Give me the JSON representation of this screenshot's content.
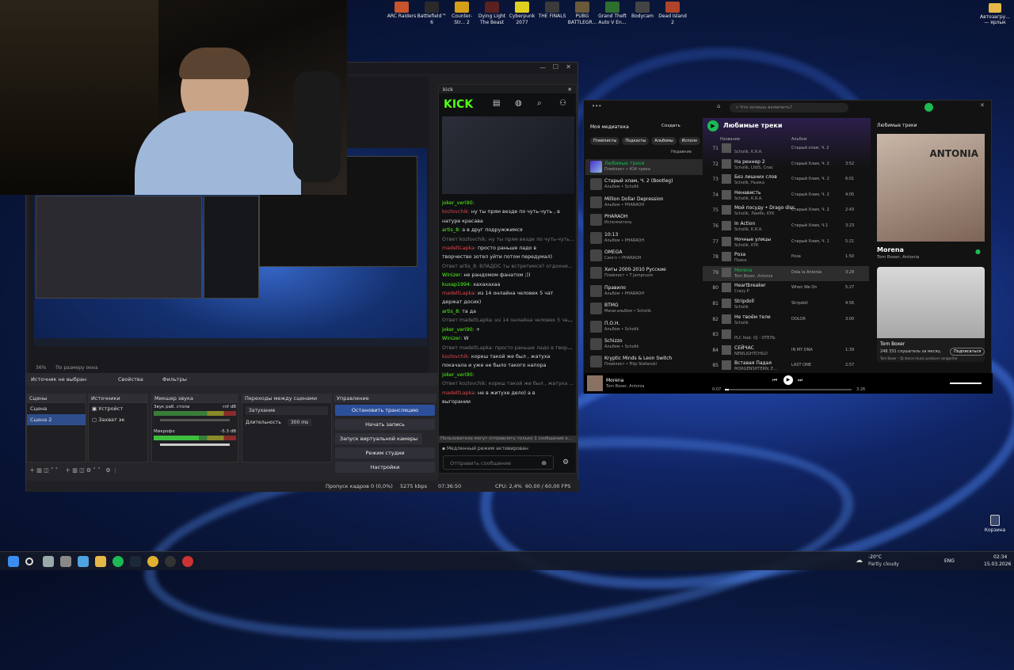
{
  "desktop": {
    "icons": [
      "ARC Raiders",
      "Battlefield™ 6",
      "Counter-Str... 2",
      "Dying Light The Beast",
      "Cyberpunk 2077",
      "THE FINALS",
      "PUBG BATTLEGR...",
      "Grand Theft Auto V En...",
      "Bodycam",
      "Dead Island 2"
    ],
    "right_icon": "Автозагру... — ярлык",
    "trash": "Корзина"
  },
  "obs": {
    "zoom": "36%",
    "fit": "По размеру окна",
    "source_none": "Источник не выбран",
    "props": "Свойства",
    "filters": "Фильтры",
    "scenes_title": "Сцены",
    "scenes": [
      "Сцена",
      "Сцена 2"
    ],
    "sources_title": "Источники",
    "sources": [
      "Устройст",
      "Захват эк"
    ],
    "mixer_title": "Микшер звука",
    "mixer": [
      {
        "name": "Звук раб. стола",
        "db": "-inf dB"
      },
      {
        "name": "Микрофо",
        "db": "-5.3 dB"
      }
    ],
    "trans_title": "Переходы между сценами",
    "trans": "Затухание",
    "dur_label": "Длительность",
    "dur": "300 ms",
    "ctrl_title": "Управление",
    "controls": [
      "Остановить трансляцию",
      "Начать запись",
      "Запуск виртуальной камеры",
      "Режим студии",
      "Настройки"
    ],
    "status": {
      "dropped": "Пропуск кадров 0 (0,0%)",
      "kbps": "5275 kbps",
      "time": "07:36:50",
      "cpu": "CPU: 2,4%",
      "fps": "60,00 / 60,00 FPS"
    }
  },
  "kick": {
    "title": "kick",
    "logo": "KICK",
    "messages": [
      {
        "u": "joker_veri90:",
        "t": "",
        "c": "green"
      },
      {
        "u": "kozlovchik:",
        "t": "ну ты прям везде по чуть-чуть , в",
        "c": "red"
      },
      {
        "u": "",
        "t": "натуре красава",
        "c": ""
      },
      {
        "u": "artis_8:",
        "t": "а в друг подружжимся",
        "c": "green"
      },
      {
        "u": "",
        "t": "Ответ kozlovchik: ну ты прям везде по чуть-чуть...",
        "c": "grey"
      },
      {
        "u": "madeltLapka:",
        "t": "просто раньше ладо в",
        "c": "red"
      },
      {
        "u": "",
        "t": "творчество зотел уйти потом передумал)",
        "c": ""
      },
      {
        "u": "",
        "t": "Ответ artis_8: ВЛАДОС ты встретимся? отдохни...",
        "c": "grey"
      },
      {
        "u": "Winizer:",
        "t": "не рандомом фанатом ;))",
        "c": "green"
      },
      {
        "u": "kuxap1994:",
        "t": "хахахахаа",
        "c": "green"
      },
      {
        "u": "madeltLapka:",
        "t": "из 14 онлайна человек 5 чат",
        "c": "red"
      },
      {
        "u": "",
        "t": "держат досих)",
        "c": ""
      },
      {
        "u": "artis_8:",
        "t": "та да",
        "c": "green"
      },
      {
        "u": "",
        "t": "Ответ madeltLapka: из 14 онлайна человек 5 чат ...",
        "c": "grey"
      },
      {
        "u": "joker_veri90:",
        "t": "+",
        "c": "green"
      },
      {
        "u": "Winizer:",
        "t": "W",
        "c": "green"
      },
      {
        "u": "",
        "t": "Ответ madeltLapka: просто раньше ладо в творч...",
        "c": "grey"
      },
      {
        "u": "kozlovchik:",
        "t": "кореш такой же был , жатуха",
        "c": "red"
      },
      {
        "u": "",
        "t": "покачала и уже не было такого напора",
        "c": ""
      },
      {
        "u": "joker_veri90:",
        "t": "",
        "c": "green"
      },
      {
        "u": "",
        "t": "Ответ kozlovchik: кореш такой же был , жатуха ...",
        "c": "grey"
      },
      {
        "u": "madeltLapka:",
        "t": "не в житухе дело) а в",
        "c": "red"
      },
      {
        "u": "",
        "t": "выгорании",
        "c": ""
      }
    ],
    "warn": "Пользователи могут отправлять только 1 сообщение к...",
    "slow": "Медленный режим активирован",
    "input_ph": "Отправить сообщение"
  },
  "spotify": {
    "search_ph": "Что хочешь включить?",
    "library": "Моя медиатека",
    "create": "Создать",
    "filters": [
      "Плейлисты",
      "Подкасты",
      "Альбомы",
      "Исполн"
    ],
    "recent": "Недавние",
    "lib": [
      {
        "t": "Любимые треки",
        "s": "Плейлист • 434 трека"
      },
      {
        "t": "Старый хлам, Ч. 2 (Bootleg)",
        "s": "Альбом • Scholik"
      },
      {
        "t": "Million Dollar Depression",
        "s": "Альбом • PHARAOH"
      },
      {
        "t": "PHARAOH",
        "s": "Исполнитель"
      },
      {
        "t": "10:13",
        "s": "Альбом • PHARAOH"
      },
      {
        "t": "OMEGA",
        "s": "Сингл • PHARAOH"
      },
      {
        "t": "Хиты 2000-2010 Русские",
        "s": "Плейлист • T Jamprusm"
      },
      {
        "t": "Правило",
        "s": "Альбом • PHARAOH"
      },
      {
        "t": "ВТМG",
        "s": "Мини-альбом • Scholik"
      },
      {
        "t": "П.О.Н.",
        "s": "Альбом • Scholik"
      },
      {
        "t": "Schizzo",
        "s": "Альбом • Scholik"
      },
      {
        "t": "Kryptic Minds & Leon Switch",
        "s": "Плейлист • Filip Stefanski"
      }
    ],
    "playlist": "Любимые треки",
    "col_name": "Название",
    "col_album": "Альбом",
    "tracks": [
      {
        "n": "71",
        "t": "",
        "a": "Scholik, K.R.A.",
        "al": "Старый хлам, Ч. 2",
        "d": ""
      },
      {
        "n": "72",
        "t": "На реннер 2",
        "a": "Scholik, LfdiS, Cпас",
        "al": "Старый Хлам, Ч. 2",
        "d": "3:52"
      },
      {
        "n": "73",
        "t": "Без лишних слов",
        "a": "Scholik, Ньюка",
        "al": "Старый Хлам, Ч. 2",
        "d": "6:01"
      },
      {
        "n": "74",
        "t": "Ненависть",
        "a": "Scholik, K.R.A.",
        "al": "Старый Хлам, Ч. 2",
        "d": "4:05"
      },
      {
        "n": "75",
        "t": "Мой посуду • Drago diss",
        "a": "Scholik, Ламбо, KYK",
        "al": "Старый Хлам, Ч. 2",
        "d": "2:43"
      },
      {
        "n": "76",
        "t": "In Action",
        "a": "Scholik, K.R.A.",
        "al": "Старый Хлам, Ч.1",
        "d": "3:23"
      },
      {
        "n": "77",
        "t": "Ночные улицы",
        "a": "Scholik, KYK",
        "al": "Старый Хлам, Ч. 1",
        "d": "5:21"
      },
      {
        "n": "78",
        "t": "Роза",
        "a": "Поиск",
        "al": "Роза",
        "d": "1:50"
      },
      {
        "n": "79",
        "t": "Morena",
        "a": "Tom Boxer, Antonia",
        "al": "Dola la Antonia",
        "d": "3:29"
      },
      {
        "n": "80",
        "t": "Heartbreaker",
        "a": "Crazy P",
        "al": "When We On",
        "d": "5:27"
      },
      {
        "n": "81",
        "t": "Stripdoll",
        "a": "Scholik",
        "al": "Stripdoll",
        "d": "4:56"
      },
      {
        "n": "82",
        "t": "Не твоём теле",
        "a": "Scholik",
        "al": "DOLOR",
        "d": "3:00"
      },
      {
        "n": "83",
        "t": "",
        "a": "PLC feat. OJ - OTEЛЬ",
        "al": "",
        "d": ""
      },
      {
        "n": "84",
        "t": "СЕЙЧАС",
        "a": "NEWLIGHTCHILD",
        "al": "IN MY DNA",
        "d": "1:39"
      },
      {
        "n": "85",
        "t": "Вставая Падая",
        "a": "MORGENSHTERN, Е...",
        "al": "LAST ONE",
        "d": "2:57"
      }
    ],
    "np_panel": "Любимые треки",
    "np_title": "Morena",
    "np_artist": "Tom Boxer, Antonia",
    "cover_text": "ANTONIA",
    "artist_name": "Tom Boxer",
    "listeners": "248 331 слушатель за месяц",
    "subscribe": "Подписаться",
    "artist_bio": "Tom Boxer – DJ dance music producer songwriter",
    "bar_title": "Morena",
    "bar_artist": "Tom Boxer, Antonia",
    "t_cur": "0:07",
    "t_tot": "3:26",
    "progress": 0.03
  },
  "taskbar": {
    "weather": "-20°C",
    "weather2": "Partly cloudy",
    "lang": "ENG",
    "time": "02:34",
    "date": "15.03.2026"
  }
}
